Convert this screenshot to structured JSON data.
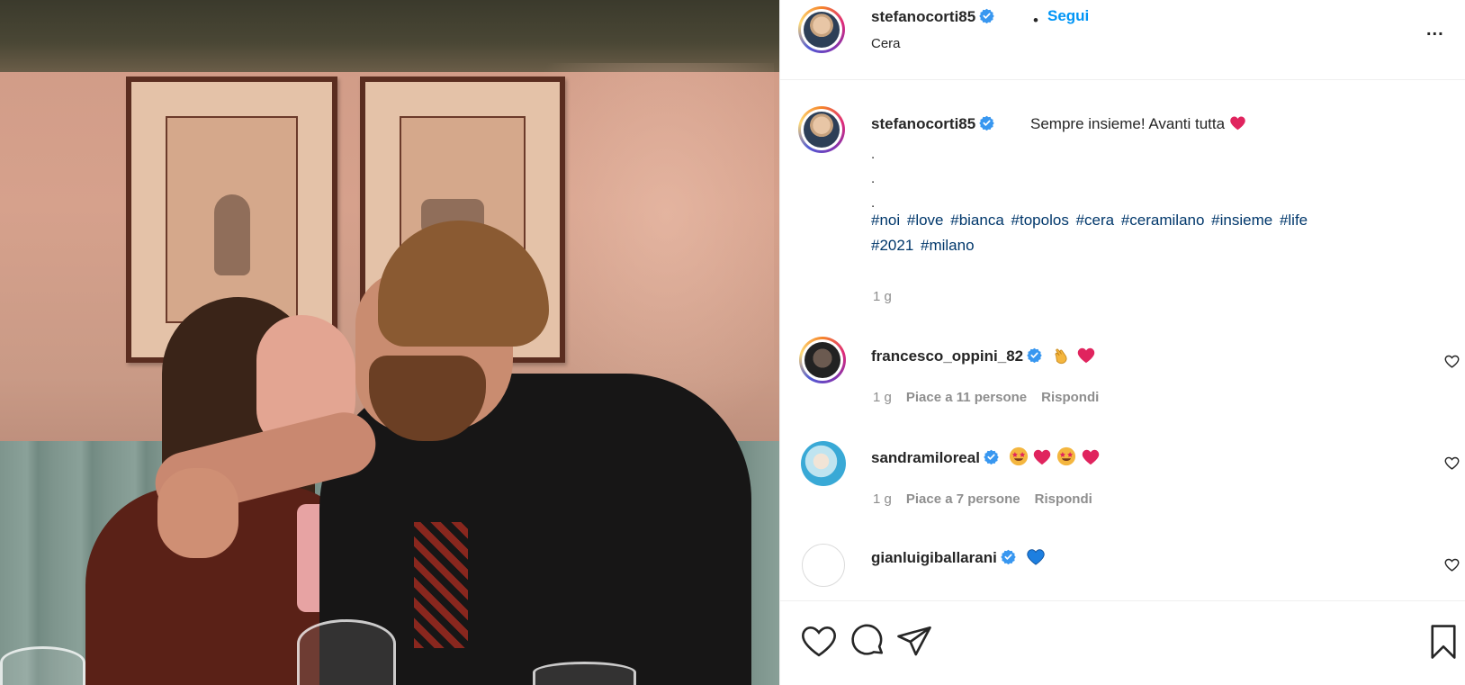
{
  "post": {
    "author": "stefanocorti85",
    "follow_label": "Segui",
    "separator": "•",
    "location": "Cera",
    "more_label": "..."
  },
  "caption": {
    "username": "stefanocorti85",
    "text": "Sempre insieme! Avanti tutta",
    "dots": [
      ".",
      ".",
      "."
    ],
    "hashtags": [
      "#noi",
      "#love",
      "#bianca",
      "#topolos",
      "#cera",
      "#ceramilano",
      "#insieme",
      "#life",
      "#2021",
      "#milano"
    ],
    "time": "1 g"
  },
  "comments": [
    {
      "username": "francesco_oppini_82",
      "time": "1 g",
      "likes": "Piace a 11 persone",
      "reply": "Rispondi"
    },
    {
      "username": "sandramiloreal",
      "time": "1 g",
      "likes": "Piace a 7 persone",
      "reply": "Rispondi"
    },
    {
      "username": "gianluigiballarani"
    }
  ],
  "colors": {
    "link_blue": "#0095f6",
    "hashtag": "#00376b",
    "verified": "#3897f0",
    "meta_grey": "#8e8e8e"
  },
  "icons": [
    "verified-badge-icon",
    "heart-icon",
    "comment-icon",
    "share-icon",
    "bookmark-icon",
    "more-icon"
  ]
}
